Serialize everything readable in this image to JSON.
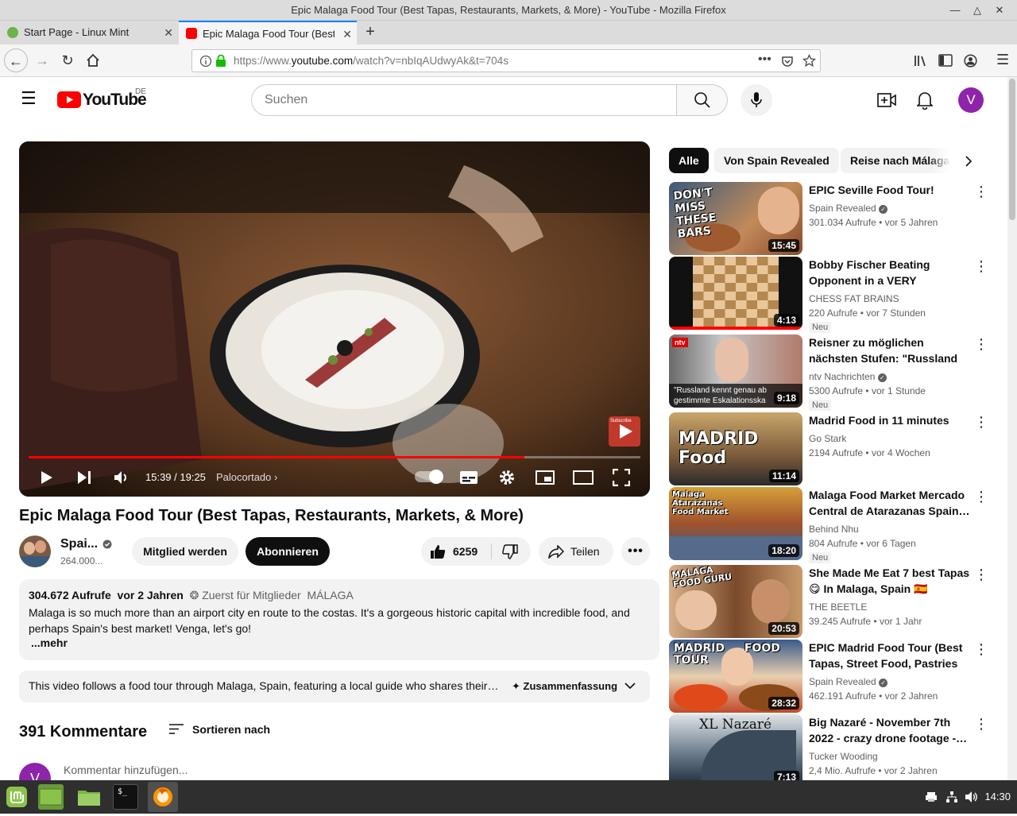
{
  "window": {
    "title": "Epic Malaga Food Tour (Best Tapas, Restaurants, Markets, & More) - YouTube - Mozilla Firefox"
  },
  "tabs": [
    {
      "label": "Start Page - Linux Mint"
    },
    {
      "label": "Epic Malaga Food Tour (Best Tapas, Restaurants, Markets, & More)"
    }
  ],
  "address": {
    "url_prefix": "https://www.",
    "url_domain": "youtube.com",
    "url_rest": "/watch?v=nbIqAUdwyAk&t=704s"
  },
  "youtube": {
    "logo_text": "YouTube",
    "region": "DE",
    "search_placeholder": "Suchen",
    "avatar_letter": "V"
  },
  "player": {
    "time": "15:39 / 19:25",
    "chapter": "Palocortado",
    "subscribe_watermark": "Subscribe",
    "progress_fraction": 0.81
  },
  "video": {
    "title": "Epic Malaga Food Tour (Best Tapas, Restaurants, Markets, & More)",
    "channel_short": "Spai...",
    "subscribers": "264.000...",
    "join_label": "Mitglied werden",
    "subscribe_label": "Abonnieren",
    "likes": "6259",
    "share_label": "Teilen"
  },
  "description": {
    "views": "304.672 Aufrufe",
    "age": "vor 2 Jahren",
    "members_first": "Zuerst für Mitglieder",
    "location": "MÁLAGA",
    "text": "Malaga is so much more than an airport city en route to the costas. It's a gorgeous historic capital with incredible food, and perhaps Spain's best market!  Venga, let's go!",
    "more": "...mehr"
  },
  "summary": {
    "text": "This video follows a food tour through Malaga, Spain, featuring a local guide who shares their…",
    "button": "Zusammenfassung"
  },
  "comments": {
    "count": "391 Kommentare",
    "sort_label": "Sortieren nach",
    "placeholder": "Kommentar hinzufügen...",
    "avatar_letter": "V"
  },
  "chips": [
    "Alle",
    "Von Spain Revealed",
    "Reise nach Málaga"
  ],
  "recommendations": [
    {
      "title": "EPIC Seville Food Tour!",
      "channel": "Spain Revealed",
      "verified": true,
      "views": "301.034 Aufrufe",
      "age": "vor 5 Jahren",
      "duration": "15:45",
      "new": "",
      "thumb_text": "DON'T MISS THESE BARS"
    },
    {
      "title": "Bobby Fischer Beating Opponent in a VERY ANNOYING…",
      "channel": "CHESS FAT BRAINS",
      "verified": false,
      "views": "220 Aufrufe",
      "age": "vor 7 Stunden",
      "duration": "4:13",
      "new": "Neu",
      "thumb_text": ""
    },
    {
      "title": "Reisner zu möglichen nächsten Stufen: \"Russland kennt gena…",
      "channel": "ntv Nachrichten",
      "verified": true,
      "views": "5300 Aufrufe",
      "age": "vor 1 Stunde",
      "duration": "9:18",
      "new": "Neu",
      "thumb_text": "\"Russland kennt genau ab gestimmte Eskalationsska"
    },
    {
      "title": "Madrid Food in 11 minutes",
      "channel": "Go Stark",
      "verified": false,
      "views": "2194 Aufrufe",
      "age": "vor 4 Wochen",
      "duration": "11:14",
      "new": "",
      "thumb_text": "MADRID Food"
    },
    {
      "title": "Malaga Food Market Mercado Central de Atarazanas Spain…",
      "channel": "Behind Nhu",
      "verified": false,
      "views": "804 Aufrufe",
      "age": "vor 6 Tagen",
      "duration": "18:20",
      "new": "Neu",
      "thumb_text": "Malaga Atarazanas Food Market"
    },
    {
      "title": "She Made Me Eat 7 best Tapas 😋 In Malaga, Spain 🇪🇸",
      "channel": "THE BEETLE",
      "verified": false,
      "views": "39.245 Aufrufe",
      "age": "vor 1 Jahr",
      "duration": "20:53",
      "new": "",
      "thumb_text": "MALAGA FOOD GURU"
    },
    {
      "title": "EPIC Madrid Food Tour (Best Tapas, Street Food, Pastries &…",
      "channel": "Spain Revealed",
      "verified": true,
      "views": "462.191 Aufrufe",
      "age": "vor 2 Jahren",
      "duration": "28:32",
      "new": "",
      "thumb_text": "MADRID FOOD TOUR"
    },
    {
      "title": "Big Nazaré - November 7th 2022 - crazy drone footage -…",
      "channel": "Tucker Wooding",
      "verified": false,
      "views": "2,4 Mio. Aufrufe",
      "age": "vor 2 Jahren",
      "duration": "7:13",
      "new": "",
      "thumb_text": "XL Nazaré"
    }
  ],
  "taskbar": {
    "clock": "14:30"
  }
}
